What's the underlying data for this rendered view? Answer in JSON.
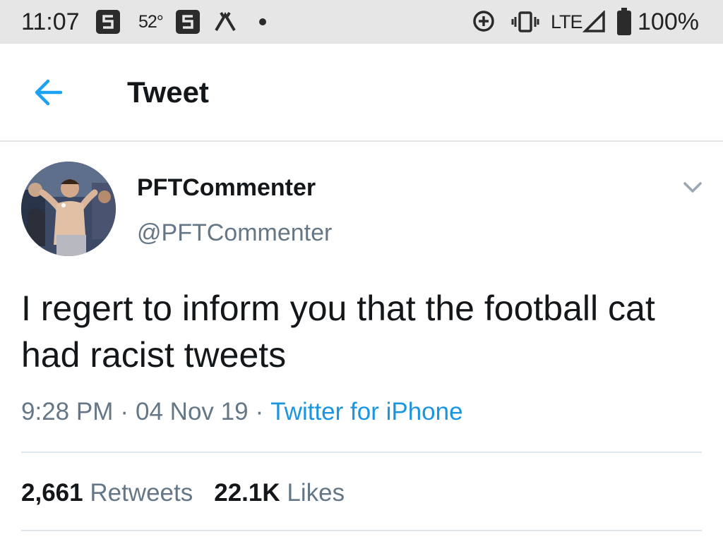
{
  "status_bar": {
    "time": "11:07",
    "temperature": "52°",
    "network": "LTE",
    "battery": "100%"
  },
  "header": {
    "title": "Tweet"
  },
  "tweet": {
    "display_name": "PFTCommenter",
    "handle": "@PFTCommenter",
    "text": "I regert to inform you that the football cat had racist tweets",
    "time": "9:28 PM",
    "date": "04 Nov 19",
    "separator": "·",
    "source": "Twitter for iPhone",
    "retweet_count": "2,661",
    "retweet_label": "Retweets",
    "like_count": "22.1K",
    "like_label": "Likes"
  },
  "colors": {
    "accent": "#1b95e0",
    "secondary_text": "#657786",
    "primary_text": "#14171a",
    "status_bar_bg": "#e6e6e6"
  },
  "icons": {
    "back": "arrow-left-icon",
    "more": "chevron-down-icon",
    "avatar": "avatar"
  }
}
